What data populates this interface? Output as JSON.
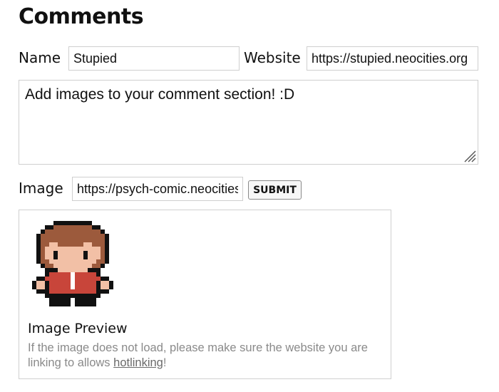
{
  "form": {
    "title": "Comments",
    "name_label": "Name",
    "name_value": "Stupied",
    "website_label": "Website",
    "website_value": "https://stupied.neocities.org",
    "comment_value": "Add images to your comment section! :D",
    "image_label": "Image",
    "image_value": "https://psych-comic.neocities.org",
    "submit_label": "SUBMIT"
  },
  "preview": {
    "sprite_name": "pixel-character-image",
    "title": "Image Preview",
    "note_before": "If the image does not load, please make sure the website you are linking to allows ",
    "note_link": "hotlinking",
    "note_after": "!"
  },
  "colors": {
    "hair": "#9c5a3c",
    "skin": "#f2c0a6",
    "shirt": "#c8453a",
    "outline": "#111111"
  }
}
